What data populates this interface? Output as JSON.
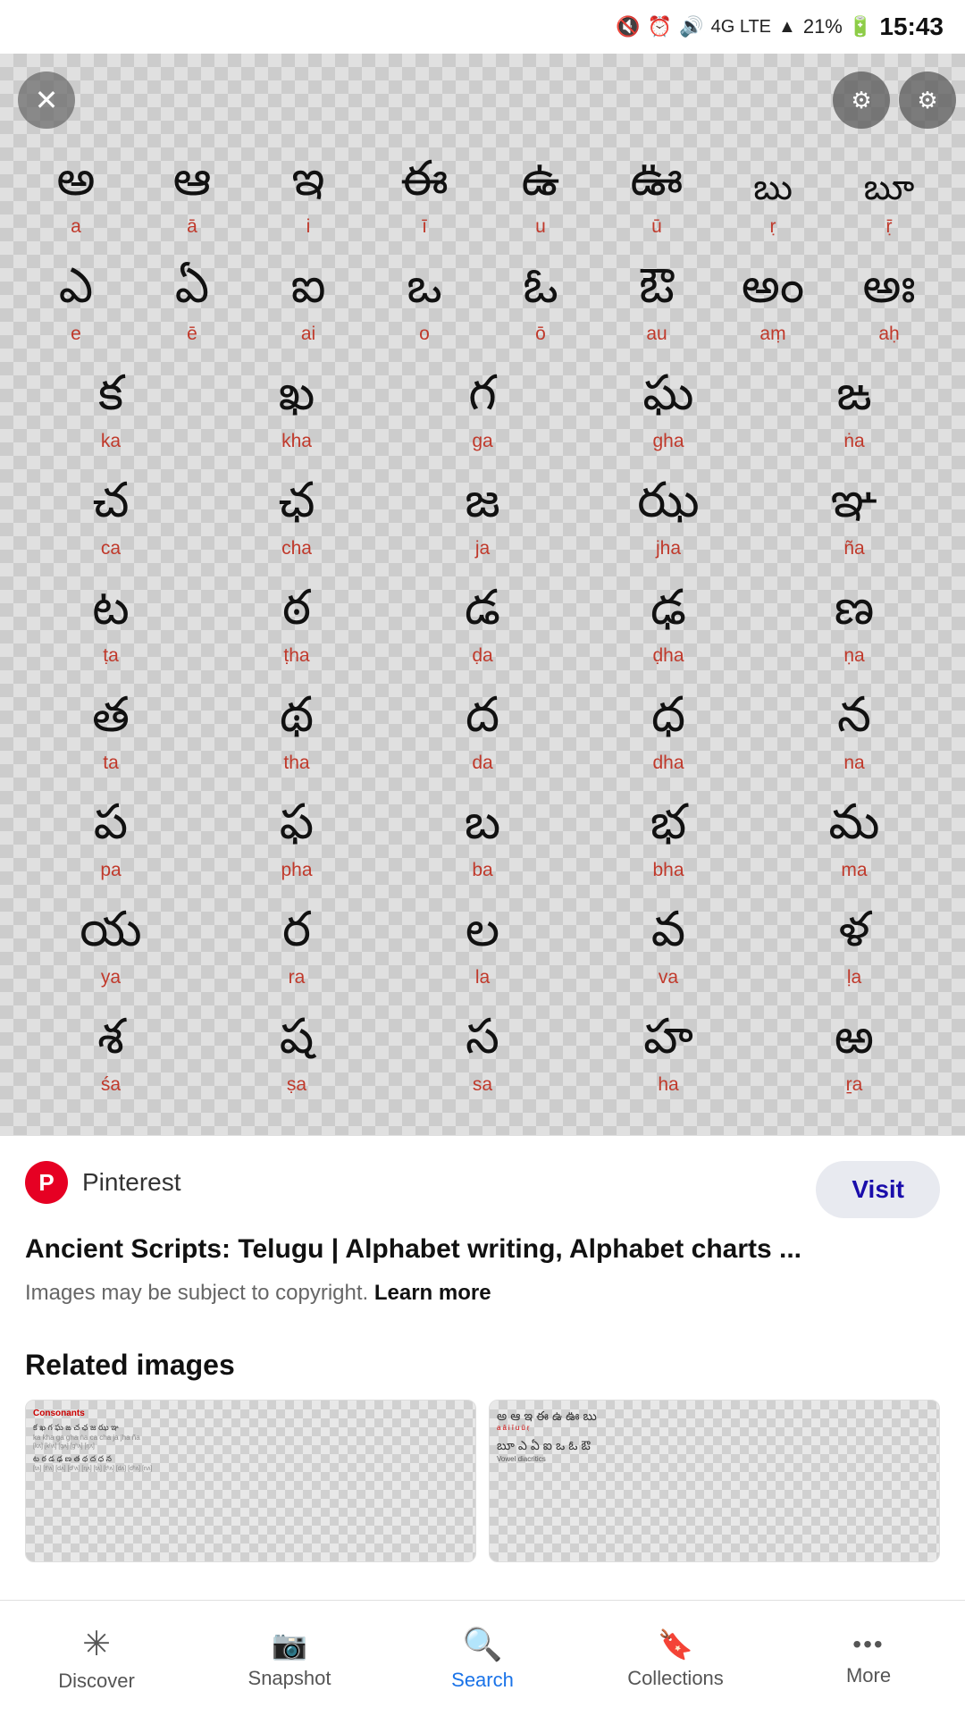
{
  "statusBar": {
    "mute": "🔇",
    "alarm": "⏰",
    "volume": "🔊",
    "network": "4G LTE",
    "signal": "📶",
    "battery": "21%",
    "time": "15:43"
  },
  "image": {
    "alt": "Telugu Alphabet Chart"
  },
  "vowels": [
    {
      "char": "అ",
      "label": "a"
    },
    {
      "char": "ఆ",
      "label": "ā"
    },
    {
      "char": "ఇ",
      "label": "i"
    },
    {
      "char": "ఈ",
      "label": "ī"
    },
    {
      "char": "ఉ",
      "label": "u"
    },
    {
      "char": "ఊ",
      "label": "ū"
    },
    {
      "char": "బు",
      "label": "ṛ"
    },
    {
      "char": "బూ",
      "label": "ṝ"
    },
    {
      "char": "ఎ",
      "label": "e"
    },
    {
      "char": "ఏ",
      "label": "ē"
    },
    {
      "char": "ఐ",
      "label": "ai"
    },
    {
      "char": "ఒ",
      "label": "o"
    },
    {
      "char": "ఓ",
      "label": "ō"
    },
    {
      "char": "ఔ",
      "label": "au"
    },
    {
      "char": "అం",
      "label": "aṃ"
    },
    {
      "char": "అః",
      "label": "aḥ"
    }
  ],
  "consonants": [
    {
      "char": "క",
      "label": "ka"
    },
    {
      "char": "ఖ",
      "label": "kha"
    },
    {
      "char": "గ",
      "label": "ga"
    },
    {
      "char": "ఘ",
      "label": "gha"
    },
    {
      "char": "ఙ",
      "label": "ṅa"
    },
    {
      "char": "చ",
      "label": "ca"
    },
    {
      "char": "ఛ",
      "label": "cha"
    },
    {
      "char": "జ",
      "label": "ja"
    },
    {
      "char": "ఝ",
      "label": "jha"
    },
    {
      "char": "ఞ",
      "label": "ña"
    },
    {
      "char": "ట",
      "label": "ṭa"
    },
    {
      "char": "ఠ",
      "label": "ṭha"
    },
    {
      "char": "డ",
      "label": "ḍa"
    },
    {
      "char": "ఢ",
      "label": "ḍha"
    },
    {
      "char": "ణ",
      "label": "ṇa"
    },
    {
      "char": "త",
      "label": "ta"
    },
    {
      "char": "థ",
      "label": "tha"
    },
    {
      "char": "ద",
      "label": "da"
    },
    {
      "char": "ధ",
      "label": "dha"
    },
    {
      "char": "న",
      "label": "na"
    },
    {
      "char": "ప",
      "label": "pa"
    },
    {
      "char": "ఫ",
      "label": "pha"
    },
    {
      "char": "బ",
      "label": "ba"
    },
    {
      "char": "భ",
      "label": "bha"
    },
    {
      "char": "మ",
      "label": "ma"
    },
    {
      "char": "య",
      "label": "ya"
    },
    {
      "char": "ర",
      "label": "ra"
    },
    {
      "char": "ల",
      "label": "la"
    },
    {
      "char": "వ",
      "label": "va"
    },
    {
      "char": "ళ",
      "label": "ḷa"
    },
    {
      "char": "శ",
      "label": "śa"
    },
    {
      "char": "ష",
      "label": "ṣa"
    },
    {
      "char": "స",
      "label": "sa"
    },
    {
      "char": "హ",
      "label": "ha"
    },
    {
      "char": "ఱ",
      "label": "ṟa"
    }
  ],
  "source": {
    "platform": "Pinterest",
    "icon_text": "P",
    "title": "Ancient Scripts: Telugu | Alphabet writing, Alphabet charts ...",
    "copyright": "Images may be subject to copyright.",
    "learnMore": "Learn more",
    "visitLabel": "Visit"
  },
  "related": {
    "title": "Related images",
    "items": [
      {
        "alt": "Telugu Consonants Chart 1"
      },
      {
        "alt": "Telugu Vowels Chart 2"
      }
    ]
  },
  "nav": {
    "items": [
      {
        "label": "Discover",
        "icon": "✳",
        "active": false
      },
      {
        "label": "Snapshot",
        "icon": "📷",
        "active": false
      },
      {
        "label": "Search",
        "icon": "🔍",
        "active": true
      },
      {
        "label": "Collections",
        "icon": "🔖",
        "active": false
      },
      {
        "label": "More",
        "icon": "•••",
        "active": false
      }
    ]
  }
}
